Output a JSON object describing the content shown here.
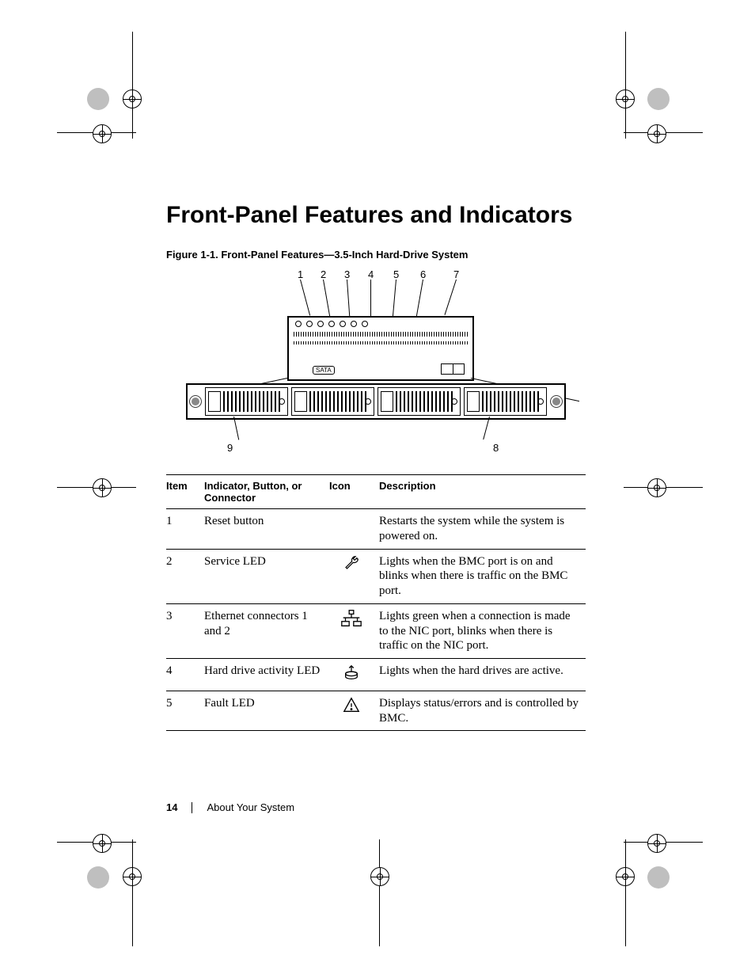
{
  "heading": "Front-Panel Features and Indicators",
  "figure_caption": "Figure 1-1.    Front-Panel Features—3.5-Inch Hard-Drive System",
  "internal_label": "SATA",
  "callouts_top": [
    "1",
    "2",
    "3",
    "4",
    "5",
    "6",
    "7"
  ],
  "callouts_bottom_left": "9",
  "callouts_bottom_right": "8",
  "table": {
    "headers": {
      "item": "Item",
      "indicator": "Indicator, Button, or Connector",
      "icon": "Icon",
      "description": "Description"
    },
    "rows": [
      {
        "item": "1",
        "indicator": "Reset button",
        "icon": "none",
        "description": "Restarts the system while the system is powered on."
      },
      {
        "item": "2",
        "indicator": "Service LED",
        "icon": "wrench",
        "description": "Lights when the BMC port is on and blinks when there is traffic on the BMC port."
      },
      {
        "item": "3",
        "indicator": "Ethernet connectors 1 and 2",
        "icon": "ethernet",
        "description": "Lights green when a connection is made to the NIC port, blinks when there is traffic on the NIC port."
      },
      {
        "item": "4",
        "indicator": "Hard drive activity LED",
        "icon": "hdd",
        "description": "Lights when the hard drives are active."
      },
      {
        "item": "5",
        "indicator": "Fault LED",
        "icon": "warning",
        "description": "Displays status/errors and is controlled by BMC."
      }
    ]
  },
  "footer": {
    "page_number": "14",
    "section_title": "About Your System"
  }
}
